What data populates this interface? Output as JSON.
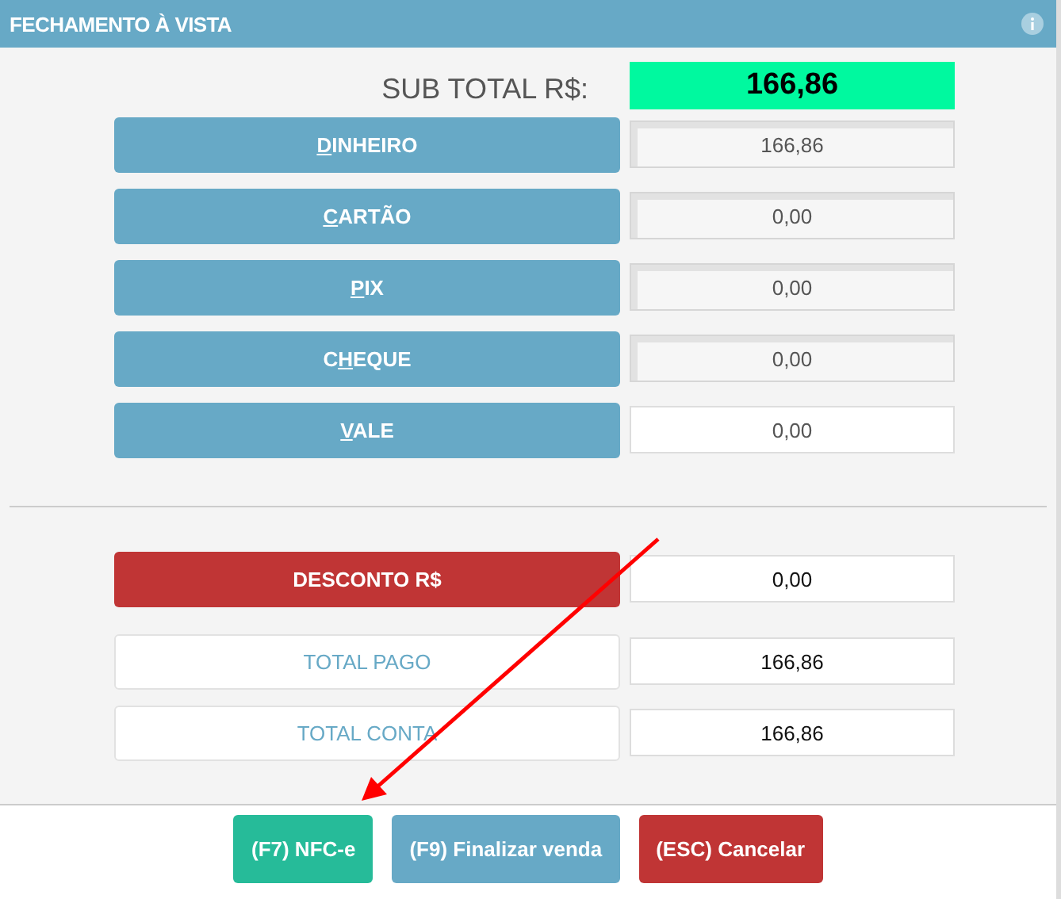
{
  "window": {
    "title": "FECHAMENTO À VISTA"
  },
  "subtotal": {
    "label": "SUB TOTAL R$:",
    "value": "166,86"
  },
  "payments": [
    {
      "key": "D",
      "post": "INHEIRO",
      "value": "166,86",
      "disabled": true
    },
    {
      "key": "C",
      "post": "ARTÃO",
      "value": "0,00",
      "disabled": true
    },
    {
      "key": "P",
      "post": "IX",
      "value": "0,00",
      "disabled": true
    },
    {
      "pre": "C",
      "key": "H",
      "post": "EQUE",
      "value": "0,00",
      "disabled": true
    },
    {
      "key": "V",
      "post": "ALE",
      "value": "0,00",
      "disabled": false
    }
  ],
  "summary": [
    {
      "kind": "discount",
      "label": "DESCONTO R$",
      "value": "0,00"
    },
    {
      "kind": "total",
      "label": "TOTAL PAGO",
      "value": "166,86"
    },
    {
      "kind": "total",
      "label": "TOTAL CONTA",
      "value": "166,86"
    }
  ],
  "buttons": [
    {
      "kind": "nfce",
      "label": "(F7) NFC-e"
    },
    {
      "kind": "finish",
      "label": "(F9) Finalizar venda"
    },
    {
      "kind": "cancel",
      "label": "(ESC) Cancelar"
    }
  ]
}
